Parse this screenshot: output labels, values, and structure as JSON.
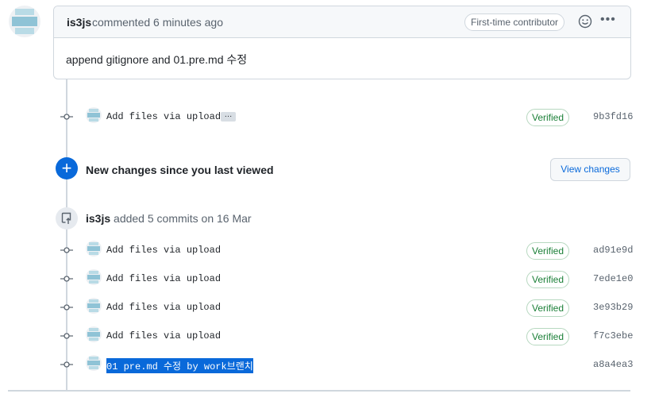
{
  "comment": {
    "author": "is3js",
    "action": "commented 6 minutes ago",
    "badge": "First-time contributor",
    "body": "append gitignore and 01.pre.md 수정",
    "icons": [
      "avatar",
      "smiley-icon",
      "kebab-menu-icon"
    ]
  },
  "first_commit": {
    "message": "Add files via upload",
    "expand_label": "…",
    "verified": "Verified",
    "sha": "9b3fd16"
  },
  "new_changes": {
    "label": "New changes since you last viewed",
    "button": "View changes",
    "icon": "plus-icon"
  },
  "push_event": {
    "author": "is3js",
    "text": "added 5 commits on 16 Mar",
    "icon": "repo-push-icon"
  },
  "commits": [
    {
      "message": "Add files via upload",
      "verified": "Verified",
      "sha": "ad91e9d"
    },
    {
      "message": "Add files via upload",
      "verified": "Verified",
      "sha": "7ede1e0"
    },
    {
      "message": "Add files via upload",
      "verified": "Verified",
      "sha": "3e93b29"
    },
    {
      "message": "Add files via upload",
      "verified": "Verified",
      "sha": "f7c3ebe"
    },
    {
      "message": "01 pre.md 수정 by work브랜치",
      "verified": "",
      "sha": "a8a4ea3"
    }
  ],
  "colors": {
    "accent": "#0969da",
    "verified": "#1a7f37",
    "border": "#d0d7de",
    "selection": "#0969da"
  }
}
